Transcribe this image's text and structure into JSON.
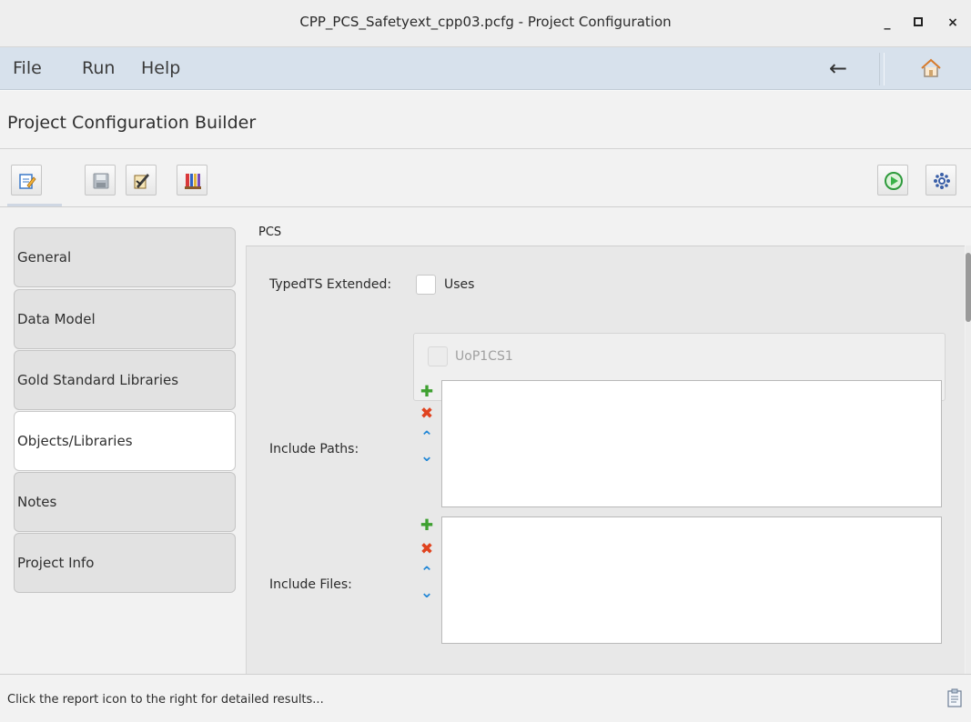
{
  "window": {
    "title": "CPP_PCS_Safetyext_cpp03.pcfg - Project Configuration",
    "minimize_label": "_",
    "maximize_label": "□",
    "close_label": "×"
  },
  "menubar": {
    "items": [
      "File",
      "Run",
      "Help"
    ],
    "back_glyph": "←"
  },
  "header": {
    "title": "Project Configuration Builder"
  },
  "toolbar": {
    "left_buttons": [
      "edit-config-icon",
      "save-icon",
      "report-edit-icon",
      "library-icon"
    ],
    "right_buttons": [
      "run-icon",
      "settings-icon"
    ]
  },
  "sidebar": {
    "items": [
      {
        "label": "General",
        "active": false
      },
      {
        "label": "Data Model",
        "active": false
      },
      {
        "label": "Gold Standard Libraries",
        "active": false
      },
      {
        "label": "Objects/Libraries",
        "active": true
      },
      {
        "label": "Notes",
        "active": false
      },
      {
        "label": "Project Info",
        "active": false
      }
    ]
  },
  "main": {
    "section_title": "PCS",
    "typedts_label": "TypedTS Extended:",
    "uses_label": "Uses",
    "uses_checked": false,
    "uop_label": "UoP1CS1",
    "uop_checked": false,
    "include_paths_label": "Include Paths:",
    "include_files_label": "Include Files:",
    "include_paths": [],
    "include_files": [],
    "list_controls": {
      "add": "✚",
      "remove": "✖",
      "up": "⌃",
      "down": "⌄"
    }
  },
  "status": {
    "message": "Click the report icon to the right for detailed results..."
  },
  "colors": {
    "menubar_bg": "#d7e1ec",
    "add": "#3ea030",
    "remove": "#e0431f",
    "move": "#2287d6",
    "run": "#3bb34a"
  }
}
